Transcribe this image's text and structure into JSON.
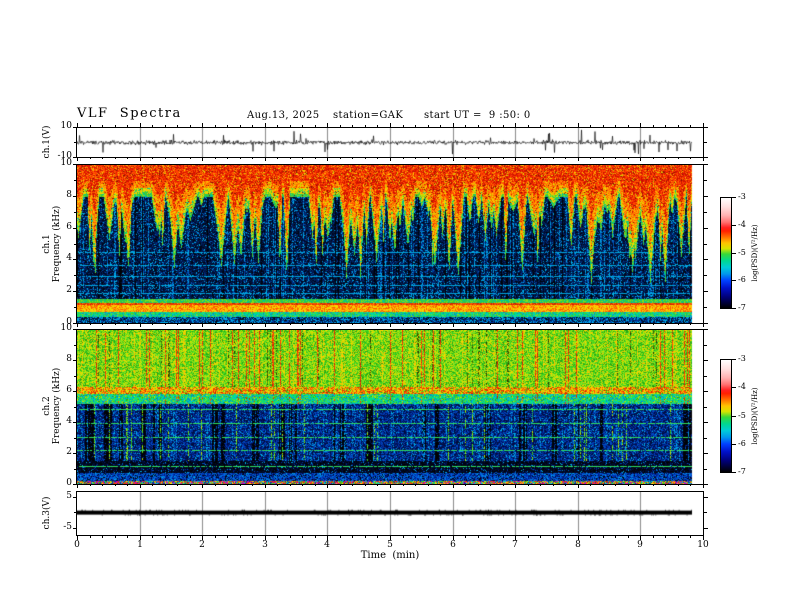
{
  "header": {
    "title": "VLF  Spectra",
    "date": "Aug.13, 2025",
    "station": "station=GAK",
    "start_ut": "start UT =  9 :50: 0"
  },
  "x_axis": {
    "label": "Time  (min)",
    "tick_labels": [
      "0",
      "1",
      "2",
      "3",
      "4",
      "5",
      "6",
      "7",
      "8",
      "9",
      "10"
    ],
    "range": [
      0,
      10
    ],
    "minor_step": 0.2
  },
  "panels": [
    {
      "id": "ch1_wave",
      "side_label": "ch.1(V)",
      "tick_labels": [
        "10",
        "-10"
      ],
      "range": [
        -10,
        10
      ]
    },
    {
      "id": "ch1_spec",
      "side_label_line1": "ch.1",
      "side_label_line2": "Frequency  (kHz)",
      "tick_labels": [
        "10",
        "8",
        "6",
        "4",
        "2",
        "0"
      ],
      "range": [
        0,
        10
      ]
    },
    {
      "id": "ch2_spec",
      "side_label_line1": "ch.2",
      "side_label_line2": "Frequency  (kHz)",
      "tick_labels": [
        "10",
        "8",
        "6",
        "4",
        "2",
        "0"
      ],
      "range": [
        0,
        10
      ]
    },
    {
      "id": "ch3_wave",
      "side_label": "ch.3(V)",
      "tick_labels": [
        "5",
        "-5"
      ],
      "range": [
        -5,
        5
      ]
    }
  ],
  "colorbars": [
    {
      "id": "cb1",
      "tick_labels": [
        "-3",
        "-4",
        "-5",
        "-6",
        "-7"
      ],
      "label": "log(PSD)(V²/Hz)"
    },
    {
      "id": "cb2",
      "tick_labels": [
        "-3",
        "-4",
        "-5",
        "-6",
        "-7"
      ],
      "label": "log(PSD)(V²/Hz)"
    }
  ],
  "chart_data": {
    "time_range_min": [
      0,
      10
    ],
    "data_end_min": 9.83,
    "panels": [
      {
        "id": "ch1_waveform",
        "type": "line",
        "ylabel": "ch.1(V)",
        "ylim": [
          -10,
          10
        ],
        "xlim": [
          0,
          10
        ],
        "description": "continuous noisy voltage trace centred near 0 V with random impulsive spikes reaching about ±9 V; record ends near 9.8 min",
        "noise_sd_V": 1.2,
        "spike_rate": 0.032,
        "spike_amp_V": [
          2,
          9
        ]
      },
      {
        "id": "ch1_spectrogram",
        "type": "heatmap",
        "ylabel": "ch.1 Frequency (kHz)",
        "ylim": [
          0,
          10
        ],
        "xlim": [
          0,
          10
        ],
        "zlabel": "log(PSD)(V²/Hz)",
        "zlim": [
          -7,
          -3
        ],
        "hlines_khz": [
          4.5,
          3.7,
          3.0,
          2.4,
          1.9
        ],
        "bands": [
          {
            "khz": [
              8.6,
              10.0
            ],
            "level": -3.6,
            "desc": "saturated red-orange noise"
          },
          {
            "khz": [
              5.5,
              8.6
            ],
            "level": -4.3,
            "desc": "red-yellow-green vertical tongues descending over dark background"
          },
          {
            "khz": [
              1.55,
              5.5
            ],
            "level": -6.4,
            "desc": "dark navy/black with cyan vertical streaks and thin cyan horizontal lines"
          },
          {
            "khz": [
              1.25,
              1.55
            ],
            "level": -4.8,
            "desc": "green band"
          },
          {
            "khz": [
              1.15,
              1.25
            ],
            "level": -3.9,
            "desc": "thin red line"
          },
          {
            "khz": [
              0.75,
              1.15
            ],
            "level": -4.1,
            "desc": "yellow-orange band"
          },
          {
            "khz": [
              0.45,
              0.75
            ],
            "level": -5.2,
            "desc": "green-cyan band"
          },
          {
            "khz": [
              0.0,
              0.45
            ],
            "level": -6.2,
            "desc": "blue/dark speckle"
          }
        ]
      },
      {
        "id": "ch2_spectrogram",
        "type": "heatmap",
        "ylabel": "ch.2 Frequency (kHz)",
        "ylim": [
          0,
          10
        ],
        "xlim": [
          0,
          10
        ],
        "zlabel": "log(PSD)(V²/Hz)",
        "zlim": [
          -7,
          -3
        ],
        "hlines_khz": [
          4.85,
          3.95,
          3.05,
          2.2,
          1.15
        ],
        "bands": [
          {
            "khz": [
              6.3,
              10.0
            ],
            "level": -4.7,
            "desc": "green/yellow mottle with vertical red and dark-olive streaks"
          },
          {
            "khz": [
              5.9,
              6.3
            ],
            "level": -3.9,
            "desc": "yellow-red horizontal band"
          },
          {
            "khz": [
              5.2,
              5.9
            ],
            "level": -5.2,
            "desc": "cyan-green mottle"
          },
          {
            "khz": [
              1.55,
              5.2
            ],
            "level": -6.3,
            "desc": "blue field with cyan vertical stripes, thin green horizontal lines, occasional full-height green streaks"
          },
          {
            "khz": [
              0.75,
              1.55
            ],
            "level": -6.9,
            "desc": "very dark band"
          },
          {
            "khz": [
              0.25,
              0.75
            ],
            "level": -6.2,
            "desc": "dark blue speckle"
          },
          {
            "khz": [
              0.0,
              0.25
            ],
            "level": -4.8,
            "desc": "multicolour speckled edge"
          }
        ]
      },
      {
        "id": "ch3_waveform",
        "type": "line",
        "ylabel": "ch.3(V)",
        "ylim": [
          -5,
          5
        ],
        "xlim": [
          0,
          10
        ],
        "value_V": 0,
        "description": "flat thick black trace at 0 V across the whole record"
      }
    ],
    "colorbar": {
      "label": "log(PSD)(V²/Hz)",
      "range_log_psd": [
        -7,
        -3
      ],
      "stops": [
        [
          0,
          "#ffffff"
        ],
        [
          8,
          "#ffe0e0"
        ],
        [
          16,
          "#ffb0b0"
        ],
        [
          22,
          "#ff7070"
        ],
        [
          27,
          "#ff2020"
        ],
        [
          30,
          "#ff2000"
        ],
        [
          35,
          "#ff6800"
        ],
        [
          41,
          "#ffc400"
        ],
        [
          46,
          "#d8e400"
        ],
        [
          51,
          "#38d838"
        ],
        [
          57,
          "#00d890"
        ],
        [
          63,
          "#00ccd8"
        ],
        [
          69,
          "#0098ec"
        ],
        [
          75,
          "#0040ff"
        ],
        [
          82,
          "#0010c8"
        ],
        [
          90,
          "#000078"
        ],
        [
          100,
          "#000000"
        ]
      ]
    },
    "palette": {
      "hot_top": [
        "#d81400",
        "#f22800",
        "#ff4000",
        "#c81000",
        "#ff5c00"
      ],
      "hot_mid": [
        "#ff6c00",
        "#ff8c00",
        "#ffa800",
        "#ff5000"
      ],
      "warm_yellow": [
        "#ffd000",
        "#e8e000",
        "#ffb800",
        "#c8d800"
      ],
      "tip_green": [
        "#48d028",
        "#20c858",
        "#00c49c",
        "#84dc20"
      ],
      "cold_dark": [
        "#000a24",
        "#00123c",
        "#001c54",
        "#000410",
        "#002468"
      ],
      "cold_cyan": [
        "#0096dc",
        "#0058bc",
        "#00b4ec",
        "#003290"
      ],
      "dark_speck": "#801800",
      "black": "#000206",
      "green_field": [
        "#38d020",
        "#5cdc1c",
        "#8ce020",
        "#c8e400",
        "#28a814"
      ],
      "olive_dark": [
        "#405c00",
        "#223400",
        "#607400"
      ],
      "red_streak": [
        "#e83000",
        "#ff5200",
        "#c82000",
        "#ff3c00"
      ],
      "band_yellow": [
        "#ffd800",
        "#ff9c00",
        "#ff5400",
        "#e8e000",
        "#ffc000"
      ],
      "checker_cyan": [
        "#00d8a0",
        "#00c8c8",
        "#38dc50",
        "#0090c8",
        "#00e870"
      ],
      "blue_field": [
        "#0030a4",
        "#001870",
        "#000c3c",
        "#0048c4",
        "#001048"
      ],
      "dark_band": [
        "#000618",
        "#000c30",
        "#000204"
      ],
      "blue_bright": [
        "#0030b0",
        "#0050d0",
        "#001878",
        "#0070e0"
      ],
      "bottom_mix": [
        "#38d020",
        "#e83000",
        "#c800c8",
        "#00c8c8",
        "#ffd800",
        "#0030a4",
        "#ff5200"
      ],
      "hline_cyan": "#00a8e0",
      "hline_green": "#30e060",
      "grid_grey": "#8a8a8a"
    }
  }
}
